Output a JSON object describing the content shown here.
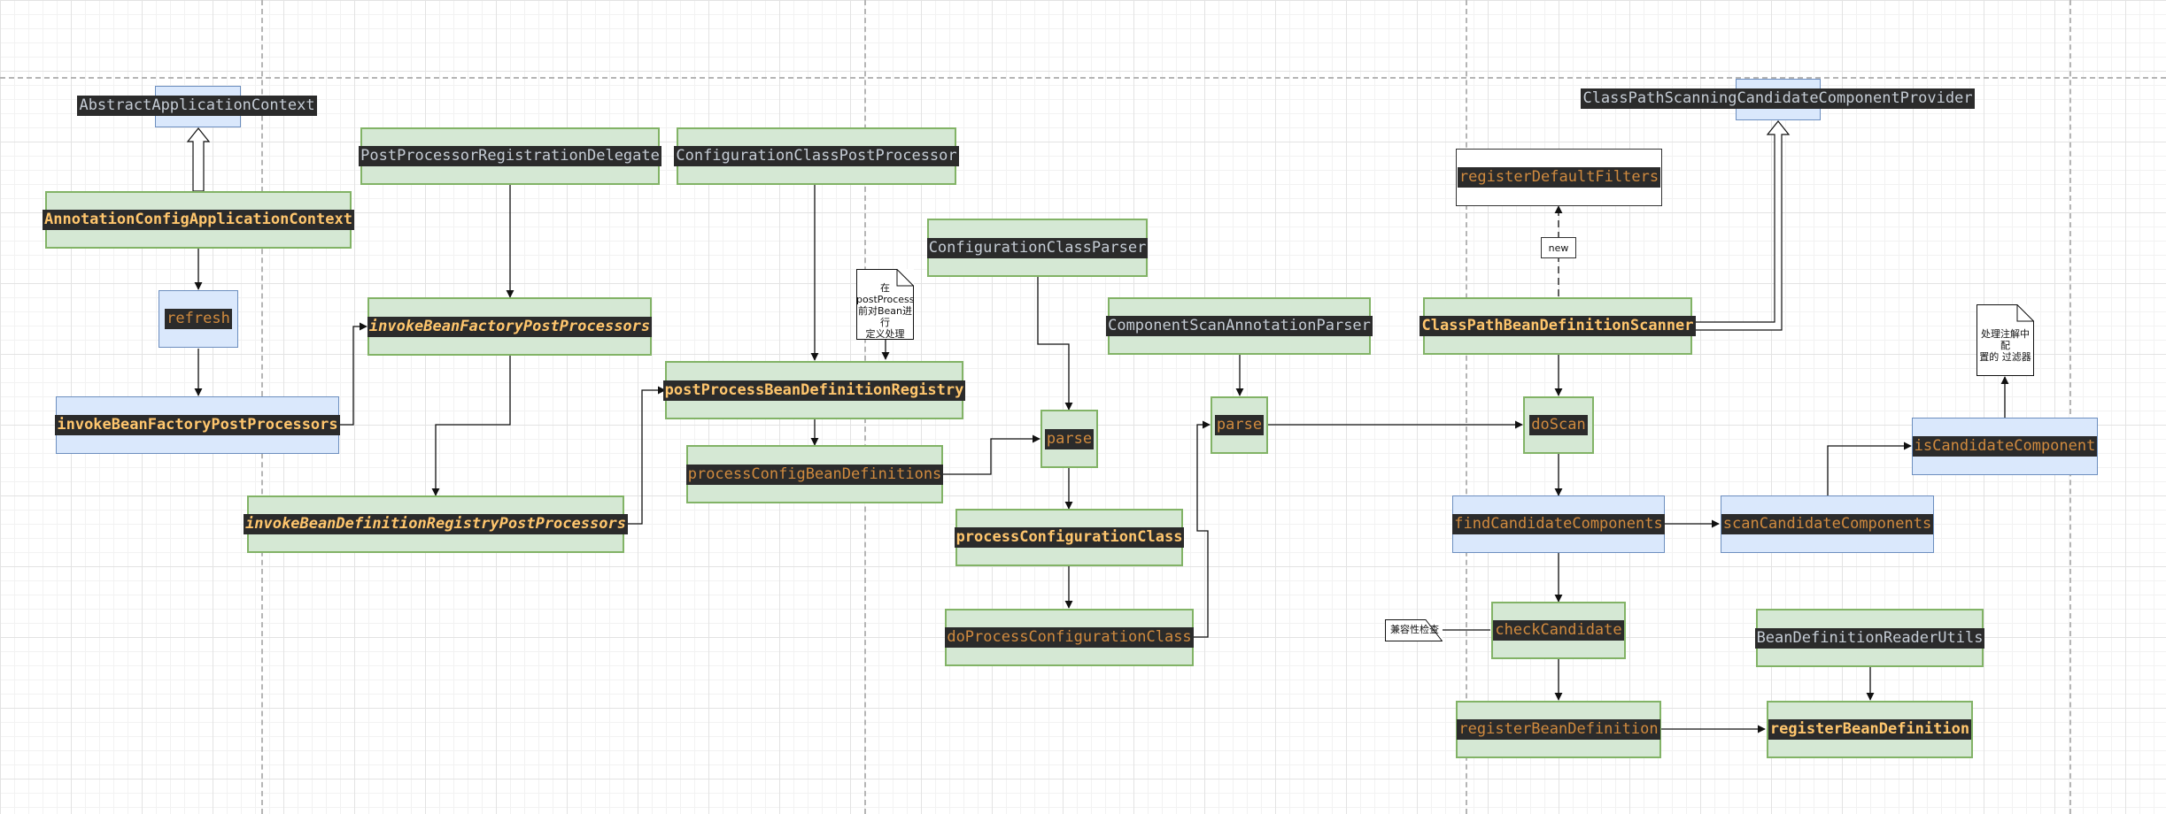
{
  "nodes": {
    "abstract_application_context": "AbstractApplicationContext",
    "annotation_config_application_context": "AnnotationConfigApplicationContext",
    "refresh": "refresh",
    "invoke_bfpp_main": "invokeBeanFactoryPostProcessors",
    "post_processor_registration_delegate": "PostProcessorRegistrationDelegate",
    "invoke_bfpp_delegate": "invokeBeanFactoryPostProcessors",
    "invoke_bdrpp": "invokeBeanDefinitionRegistryPostProcessors",
    "configuration_class_post_processor": "ConfigurationClassPostProcessor",
    "post_process_bd_registry": "postProcessBeanDefinitionRegistry",
    "process_config_bean_definitions": "processConfigBeanDefinitions",
    "configuration_class_parser": "ConfigurationClassParser",
    "parse_parser": "parse",
    "process_configuration_class": "processConfigurationClass",
    "do_process_configuration_class": "doProcessConfigurationClass",
    "component_scan_annotation_parser": "ComponentScanAnnotationParser",
    "parse_scan": "parse",
    "class_path_scanning_candidate_component_provider": "ClassPathScanningCandidateComponentProvider",
    "register_default_filters": "registerDefaultFilters",
    "class_path_bean_definition_scanner": "ClassPathBeanDefinitionScanner",
    "do_scan": "doScan",
    "find_candidate_components": "findCandidateComponents",
    "scan_candidate_components": "scanCandidateComponents",
    "is_candidate_component": "isCandidateComponent",
    "check_candidate": "checkCandidate",
    "register_bean_definition_scanner": "registerBeanDefinition",
    "bean_definition_reader_utils": "BeanDefinitionReaderUtils",
    "register_bean_definition_utils": "registerBeanDefinition"
  },
  "notes": {
    "post_process_note_line1": "在",
    "post_process_note_line2": "postProcess",
    "post_process_note_line3": "前对Bean进行",
    "post_process_note_line4": "定义处理",
    "filter_note_line1": "处理注解中配",
    "filter_note_line2": "置的 过滤器",
    "compat_note": "兼容性检查"
  },
  "edge_labels": {
    "new_label": "new"
  },
  "colors": {
    "green_fill": "#d5e8d4",
    "green_stroke": "#82b366",
    "blue_fill": "#dae8fc",
    "blue_stroke": "#6c8ebf",
    "code_background": "#2b2b2b",
    "type_name_text": "#c5ccd5",
    "method_text": "#d08a3e",
    "highlight_method_text": "#ffc66d"
  }
}
